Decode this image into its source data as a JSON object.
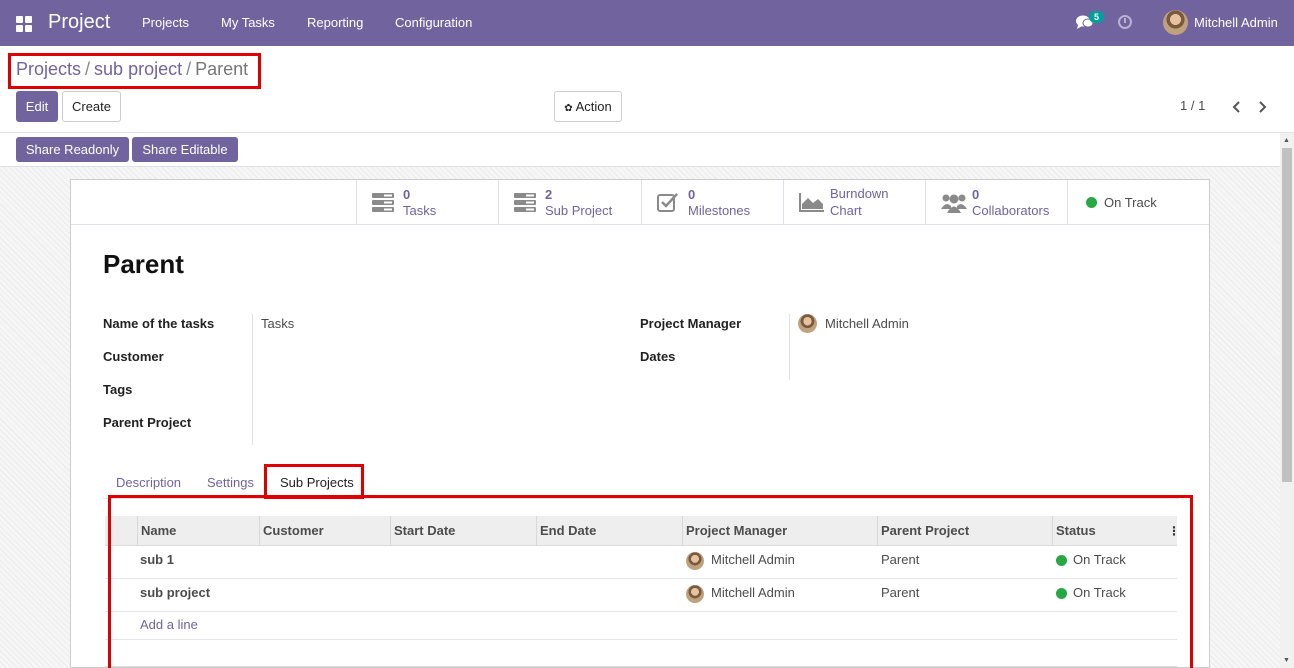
{
  "app": {
    "title": "Project",
    "notification_count": "5",
    "user_name": "Mitchell Admin"
  },
  "menu": [
    "Projects",
    "My Tasks",
    "Reporting",
    "Configuration"
  ],
  "breadcrumb": {
    "item1": "Projects",
    "item2": "sub project",
    "separator": "/",
    "current": "Parent"
  },
  "toolbar": {
    "edit": "Edit",
    "create": "Create",
    "action": "Action",
    "pager": "1 / 1",
    "share_readonly": "Share Readonly",
    "share_editable": "Share Editable"
  },
  "stats": [
    {
      "num": "0",
      "label": "Tasks",
      "icon": "tasks-icon"
    },
    {
      "num": "2",
      "label": "Sub Project",
      "icon": "sub-project-icon"
    },
    {
      "num": "0",
      "label": "Milestones",
      "icon": "milestones-check-icon"
    },
    {
      "label1": "Burndown",
      "label2": "Chart",
      "icon": "area-chart-icon"
    },
    {
      "num": "0",
      "label": "Collaborators",
      "icon": "users-icon"
    },
    {
      "label": "On Track",
      "color": "#28a745"
    }
  ],
  "record": {
    "title": "Parent"
  },
  "fields": {
    "name_tasks_label": "Name of the tasks",
    "name_tasks_value": "Tasks",
    "customer_label": "Customer",
    "tags_label": "Tags",
    "parent_project_label": "Parent Project",
    "project_manager_label": "Project Manager",
    "project_manager_value": "Mitchell Admin",
    "dates_label": "Dates"
  },
  "tabs": [
    "Description",
    "Settings",
    "Sub Projects"
  ],
  "table": {
    "columns": [
      "Name",
      "Customer",
      "Start Date",
      "End Date",
      "Project Manager",
      "Parent Project",
      "Status"
    ],
    "rows": [
      {
        "name": "sub 1",
        "manager": "Mitchell Admin",
        "parent": "Parent",
        "status": "On Track"
      },
      {
        "name": "sub project",
        "manager": "Mitchell Admin",
        "parent": "Parent",
        "status": "On Track"
      }
    ],
    "add_line": "Add a line"
  },
  "colors": {
    "brand": "#71639e",
    "status_green": "#28a745",
    "highlight_red": "#e00000",
    "badge_teal": "#00a09d"
  }
}
